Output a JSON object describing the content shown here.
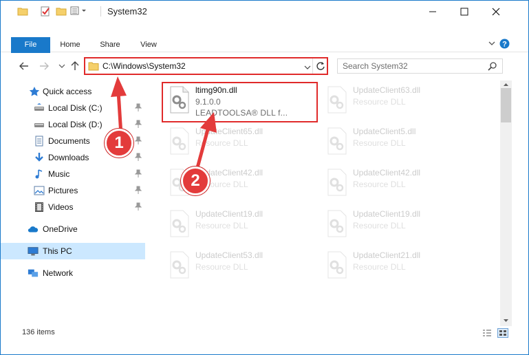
{
  "window": {
    "title": "System32",
    "controls": {
      "minimize": "minimize-icon",
      "maximize": "maximize-icon",
      "close": "close-icon"
    }
  },
  "ribbon": {
    "tabs": [
      {
        "label": "File",
        "active": true
      },
      {
        "label": "Home"
      },
      {
        "label": "Share"
      },
      {
        "label": "View"
      }
    ]
  },
  "address_bar": {
    "path": "C:\\Windows\\System32"
  },
  "search": {
    "placeholder": "Search System32"
  },
  "nav_pane": {
    "quick_access": "Quick access",
    "items": [
      {
        "label": "Local Disk (C:)",
        "icon": "drive-icon",
        "pinned": true
      },
      {
        "label": "Local Disk (D:)",
        "icon": "drive-icon",
        "pinned": true
      },
      {
        "label": "Documents",
        "icon": "documents-icon",
        "pinned": true
      },
      {
        "label": "Downloads",
        "icon": "downloads-icon",
        "pinned": true
      },
      {
        "label": "Music",
        "icon": "music-icon",
        "pinned": true
      },
      {
        "label": "Pictures",
        "icon": "pictures-icon",
        "pinned": true
      },
      {
        "label": "Videos",
        "icon": "videos-icon",
        "pinned": true
      }
    ],
    "onedrive": "OneDrive",
    "this_pc": "This PC",
    "network": "Network"
  },
  "files": [
    {
      "name": "ltimg90n.dll",
      "version": "9.1.0.0",
      "desc": "LEADTOOLSA® DLL f..."
    },
    {
      "name": "UpdateClient63.dll",
      "desc": "Resource DLL"
    },
    {
      "name": "UpdateClient65.dll",
      "desc": "Resource DLL"
    },
    {
      "name": "UpdateClient5.dll",
      "desc": "Resource DLL"
    },
    {
      "name": "UpdateClient42.dll",
      "desc": "Resource DLL"
    },
    {
      "name": "UpdateClient42.dll",
      "desc": "Resource DLL"
    },
    {
      "name": "UpdateClient19.dll",
      "desc": "Resource DLL"
    },
    {
      "name": "UpdateClient19.dll",
      "desc": "Resource DLL"
    },
    {
      "name": "UpdateClient53.dll",
      "desc": "Resource DLL"
    },
    {
      "name": "UpdateClient21.dll",
      "desc": "Resource DLL"
    }
  ],
  "status": {
    "item_count": "136 items"
  },
  "annotations": {
    "step1": "1",
    "step2": "2",
    "color": "#e33b3b"
  },
  "colors": {
    "accent": "#1979ca",
    "selection": "#cce8ff",
    "highlight": "#e02a2a"
  }
}
